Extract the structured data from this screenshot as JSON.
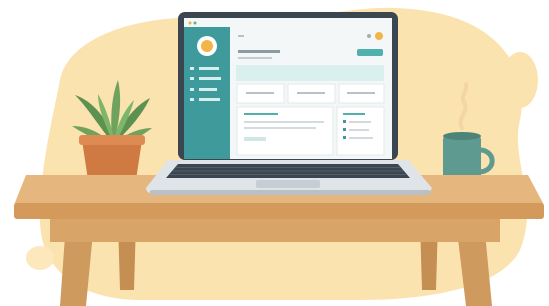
{
  "scene": {
    "palette": {
      "blob": "#fbe3b0",
      "blob_light": "#fdf0d2",
      "table_top": "#e6b67f",
      "table_edge": "#d39a5c",
      "table_leg": "#cf9a5e",
      "laptop_body": "#3b4650",
      "laptop_base": "#dfe4e8",
      "screen_bg": "#f4f7f8",
      "sidebar": "#3f9b9b",
      "accent": "#4fb0ae",
      "pot": "#d07a43",
      "plant": "#6b9e5a",
      "mug": "#5f9a90",
      "avatar": "#f1b548"
    },
    "icons": [
      "plant-icon",
      "laptop-icon",
      "mug-icon",
      "steam-icon",
      "avatar-icon",
      "search-icon",
      "notification-icon"
    ]
  }
}
